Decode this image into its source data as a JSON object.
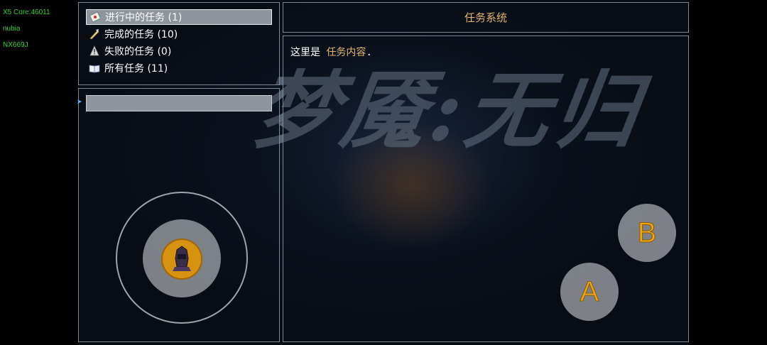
{
  "debug": {
    "core": "X5 Core:46011",
    "brand": "nubia",
    "model": "NX669J"
  },
  "background": {
    "game_title": "梦魇:无归"
  },
  "task_list": {
    "items": [
      {
        "label": "进行中的任务 (1)",
        "icon": "scroll-card-icon",
        "selected": true
      },
      {
        "label": "完成的任务 (10)",
        "icon": "quill-icon",
        "selected": false
      },
      {
        "label": "失败的任务 (0)",
        "icon": "warning-icon",
        "selected": false
      },
      {
        "label": "所有任务 (11)",
        "icon": "open-book-icon",
        "selected": false
      }
    ]
  },
  "detail": {
    "header": "任务系统",
    "content_prefix": "这里是 ",
    "content_highlight": "任务内容",
    "content_suffix": "."
  },
  "controls": {
    "button_b": "B",
    "button_a": "A"
  },
  "colors": {
    "accent": "#e3b56b",
    "selected_row": "#8f959c",
    "button_letter": "#f0a712",
    "debug_text": "#3ad13a"
  }
}
